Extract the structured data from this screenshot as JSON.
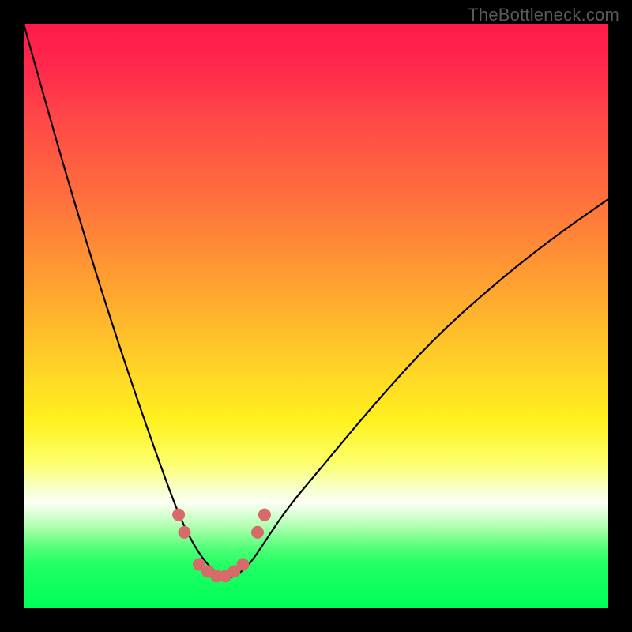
{
  "watermark": "TheBottleneck.com",
  "chart_data": {
    "type": "line",
    "title": "",
    "xlabel": "",
    "ylabel": "",
    "xlim": [
      0,
      100
    ],
    "ylim": [
      0,
      100
    ],
    "series": [
      {
        "name": "bottleneck-curve",
        "x": [
          0,
          5,
          10,
          15,
          20,
          25,
          27,
          29,
          31,
          33,
          35,
          37,
          39,
          41,
          45,
          50,
          60,
          70,
          80,
          90,
          100
        ],
        "y": [
          100,
          82,
          65,
          49,
          34,
          20,
          15,
          11,
          8,
          6,
          5,
          6,
          8,
          11,
          17,
          23,
          35,
          46,
          55,
          63,
          70
        ]
      }
    ],
    "markers": {
      "name": "highlight-dots",
      "color": "#d86a6a",
      "x": [
        26.5,
        27.5,
        30,
        31.5,
        33,
        34.5,
        36,
        37.5,
        40,
        41.2
      ],
      "y": [
        16,
        13,
        7.5,
        6.3,
        5.5,
        5.5,
        6.3,
        7.5,
        13,
        16
      ]
    },
    "gradient_stops": [
      {
        "pos": 0,
        "color": "#ff1a4b"
      },
      {
        "pos": 50,
        "color": "#ffd028"
      },
      {
        "pos": 75,
        "color": "#fdff6a"
      },
      {
        "pos": 100,
        "color": "#00ff58"
      }
    ]
  }
}
